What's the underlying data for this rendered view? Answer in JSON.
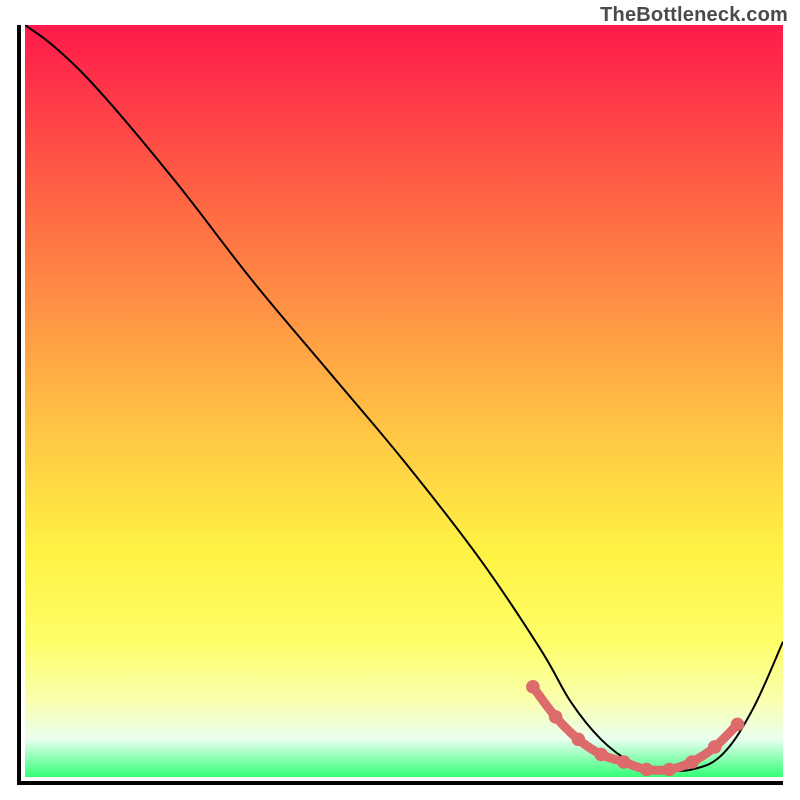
{
  "watermark": "TheBottleneck.com",
  "chart_data": {
    "type": "line",
    "title": "",
    "xlabel": "",
    "ylabel": "",
    "xlim": [
      0,
      100
    ],
    "ylim": [
      0,
      100
    ],
    "grid": false,
    "series": [
      {
        "name": "bottleneck-curve",
        "color": "#000000",
        "x": [
          0,
          4,
          10,
          20,
          30,
          40,
          50,
          60,
          68,
          72,
          76,
          80,
          84,
          88,
          92,
          96,
          100
        ],
        "values": [
          100,
          97,
          91,
          79,
          66,
          54,
          42,
          29,
          17,
          10,
          5,
          2,
          1,
          1,
          3,
          9,
          18
        ]
      },
      {
        "name": "optimal-highlight",
        "color": "#e06666",
        "x": [
          67,
          70,
          73,
          76,
          79,
          82,
          85,
          88,
          91,
          94
        ],
        "values": [
          12,
          8,
          5,
          3,
          2,
          1,
          1,
          2,
          4,
          7
        ]
      }
    ],
    "background_gradient": {
      "top_color": "#ff1a4b",
      "mid_color": "#ffe244",
      "bottom_color": "#33ff77"
    }
  }
}
